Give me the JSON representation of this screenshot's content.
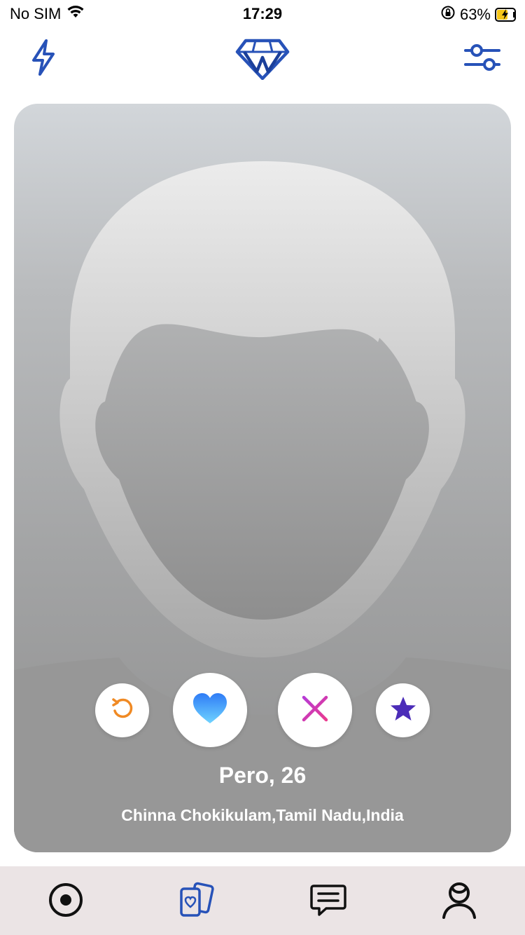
{
  "status_bar": {
    "carrier": "No SIM",
    "time": "17:29",
    "battery_percent": "63%",
    "battery_level": 0.63,
    "wifi_icon": "wifi-icon",
    "orientation_lock_icon": "orientation-lock-icon"
  },
  "top_nav": {
    "boost_icon": "lightning-icon",
    "logo_icon": "diamond-logo-icon",
    "filters_icon": "sliders-icon",
    "accent_color": "#2752b8"
  },
  "card": {
    "name_age": "Pero, 26",
    "location": "Chinna Chokikulam,Tamil Nadu,India",
    "actions": [
      {
        "name": "rewind",
        "icon": "rewind-icon",
        "color": "#f08a24"
      },
      {
        "name": "like",
        "icon": "heart-icon",
        "color": "#3aa0ff"
      },
      {
        "name": "dislike",
        "icon": "close-icon",
        "color": "#d63ab0"
      },
      {
        "name": "super-like",
        "icon": "star-icon",
        "color": "#4b2cb8"
      }
    ]
  },
  "tab_bar": {
    "tabs": [
      {
        "name": "discover",
        "icon": "record-icon",
        "active": false
      },
      {
        "name": "cards",
        "icon": "cards-icon",
        "active": true
      },
      {
        "name": "messages",
        "icon": "chat-icon",
        "active": false
      },
      {
        "name": "profile",
        "icon": "profile-icon",
        "active": false
      }
    ],
    "background": "#ebe4e5"
  }
}
